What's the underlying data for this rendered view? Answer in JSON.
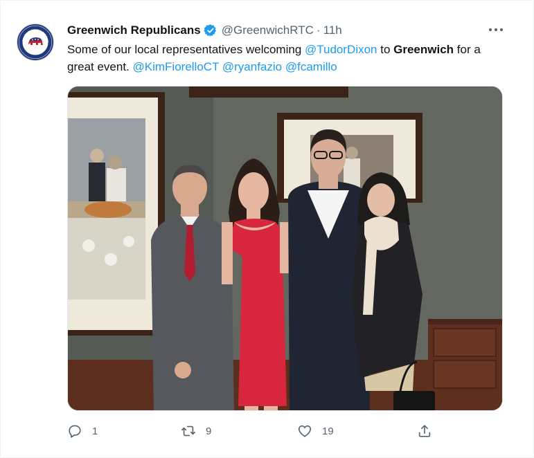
{
  "tweet": {
    "account": {
      "name": "Greenwich Republicans",
      "handle": "@GreenwichRTC",
      "separator": "·",
      "time": "11h",
      "avatar_text": {
        "top": "REPUBLICAN TOWN COMMITTEE",
        "bottom": "GREENWICH, CT"
      }
    },
    "text": {
      "part1": "Some of our local representatives welcoming ",
      "mention1": "@TudorDixon",
      "part2": " to ",
      "bold1": "Greenwich",
      "part3": " for a great event. ",
      "mention2": "@KimFiorelloCT",
      "mention3": "@ryanfazio",
      "mention4": "@fcamillo"
    },
    "actions": {
      "reply_count": "1",
      "retweet_count": "9",
      "like_count": "19"
    },
    "colors": {
      "accent": "#1d9bf0",
      "secondary_text": "#536471",
      "primary_text": "#0f1419"
    },
    "icons": [
      "verified-badge-icon",
      "more-icon",
      "reply-icon",
      "retweet-icon",
      "like-icon",
      "share-icon"
    ]
  }
}
